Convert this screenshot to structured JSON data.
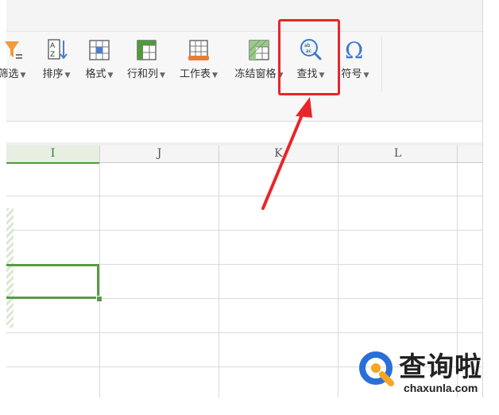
{
  "ribbon": {
    "buttons": [
      {
        "label": "筛选",
        "icon": "filter-icon"
      },
      {
        "label": "排序",
        "icon": "sort-icon"
      },
      {
        "label": "格式",
        "icon": "format-icon"
      },
      {
        "label": "行和列",
        "icon": "rows-columns-icon"
      },
      {
        "label": "工作表",
        "icon": "worksheet-icon"
      },
      {
        "label": "冻结窗格",
        "icon": "freeze-panes-icon"
      },
      {
        "label": "查找",
        "icon": "find-icon"
      },
      {
        "label": "符号",
        "icon": "symbol-icon"
      }
    ]
  },
  "columns": [
    "I",
    "J",
    "K",
    "L"
  ],
  "watermark": {
    "title": "查询啦",
    "subtitle": "chaxunla.com"
  },
  "colors": {
    "accent_green": "#5a9b46",
    "highlight_red": "#e8262a",
    "logo_blue": "#2a6fd6",
    "logo_orange": "#f5a623"
  }
}
